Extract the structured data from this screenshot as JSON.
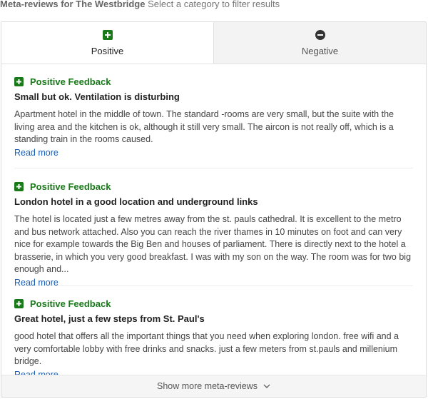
{
  "header": {
    "title": "Meta-reviews for The Westbridge",
    "hint": "Select a category to filter results"
  },
  "tabs": [
    {
      "label": "Positive",
      "icon": "plus-square-icon",
      "active": true
    },
    {
      "label": "Negative",
      "icon": "minus-circle-icon",
      "active": false
    }
  ],
  "reviews": [
    {
      "category": "Positive Feedback",
      "title": "Small but ok. Ventilation is disturbing",
      "body": "Apartment hotel in the middle of town. The standard -rooms are very small, but the suite with the living area and the kitchen is ok, although it still very small. The aircon is not really off, which is a standing train in the rooms caused.",
      "read_more": "Read more"
    },
    {
      "category": "Positive Feedback",
      "title": "London hotel in a good location and underground links",
      "body": "The hotel is located just a few metres away from the st. pauls cathedral. It is excellent to the metro and bus network attached. Also you can reach the river thames in 10 minutes on foot and can very nice for example towards the Big Ben and houses of parliament. There is directly next to the hotel a brasserie, in which you very good breakfast. I was with my son on the way. The room was for two big enough and...",
      "read_more": "Read more"
    },
    {
      "category": "Positive Feedback",
      "title": "Great hotel, just a few steps from St. Paul's",
      "body": "good hotel that offers all the important things that you need when exploring london. free wifi and a very comfortable lobby with free drinks and snacks. just a few meters from st.pauls and millenium bridge.",
      "read_more": "Read more"
    }
  ],
  "footer": {
    "label": "Show more meta-reviews",
    "icon": "chevron-down-icon"
  },
  "colors": {
    "positive": "#1a7a1a",
    "link": "#1a5fb4",
    "inactive_tab": "#f3f3f3"
  }
}
